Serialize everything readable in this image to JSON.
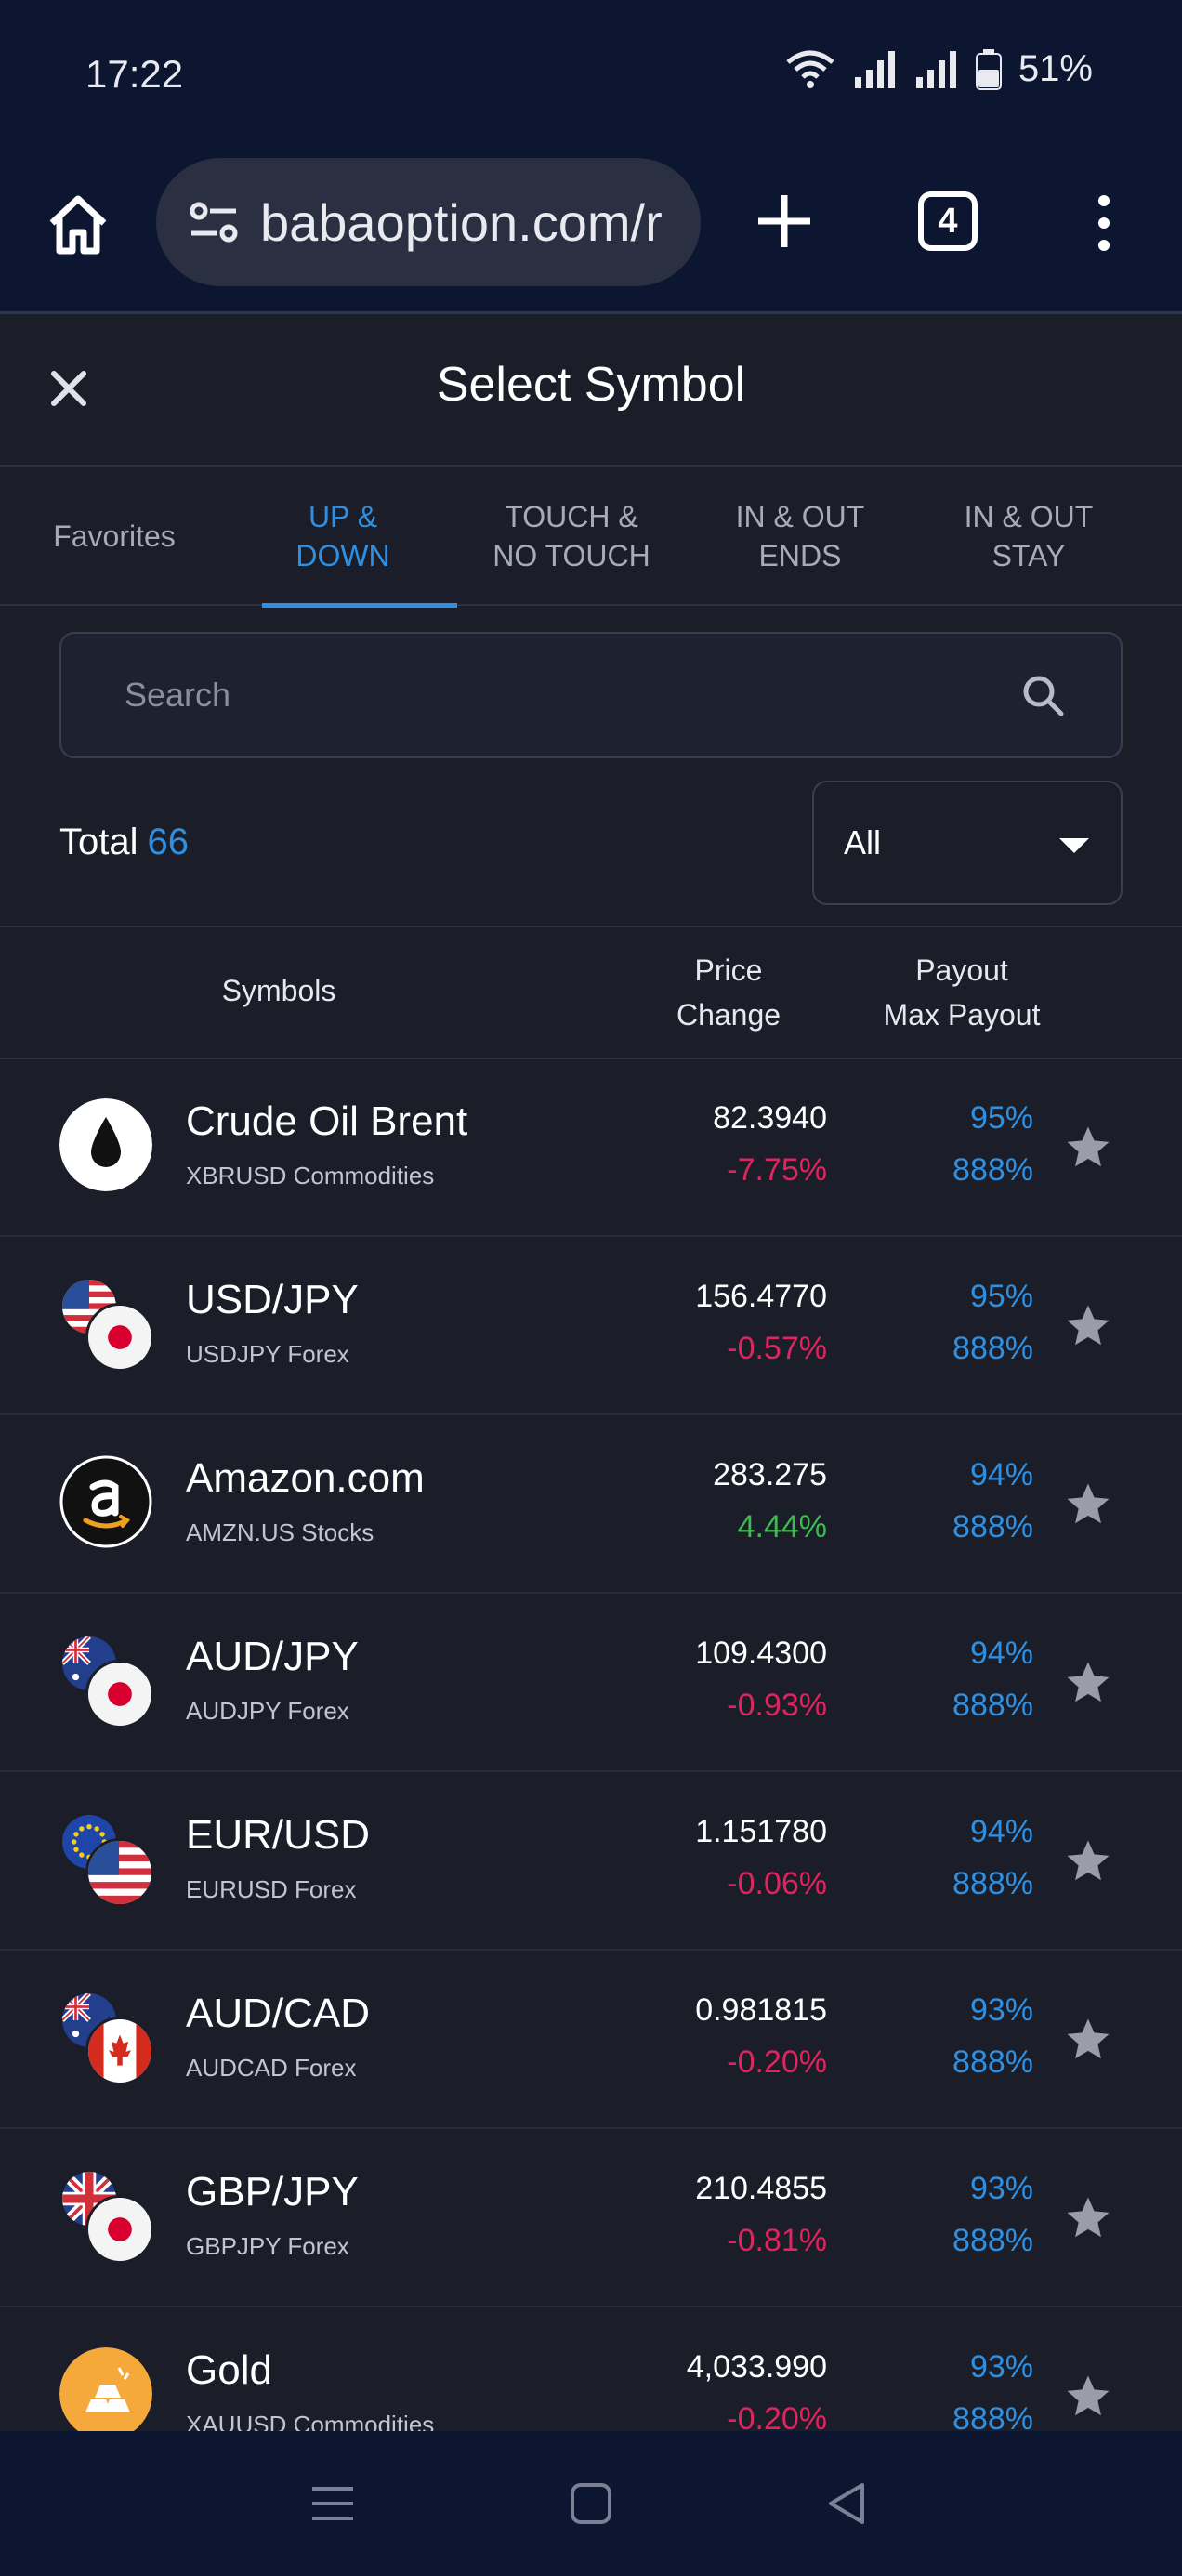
{
  "status_bar": {
    "time": "17:22",
    "battery": "51%"
  },
  "browser": {
    "url": "babaoption.com/r",
    "tab_count": "4"
  },
  "header": {
    "title": "Select Symbol"
  },
  "tabs": [
    {
      "label": "Favorites",
      "active": false
    },
    {
      "label": "UP &\nDOWN",
      "active": true
    },
    {
      "label": "TOUCH &\nNO TOUCH",
      "active": false
    },
    {
      "label": "IN & OUT\nENDS",
      "active": false
    },
    {
      "label": "IN & OUT\nSTAY",
      "active": false
    }
  ],
  "search": {
    "placeholder": "Search"
  },
  "total": {
    "label": "Total",
    "count": "66"
  },
  "filter": {
    "selected": "All"
  },
  "columns": {
    "symbols": "Symbols",
    "price": "Price",
    "change": "Change",
    "payout": "Payout",
    "max_payout": "Max Payout"
  },
  "rows": [
    {
      "name": "Crude Oil Brent",
      "sub": "XBRUSD Commodities",
      "price": "82.3940",
      "change": "-7.75%",
      "payout": "95%",
      "max_payout": "888%"
    },
    {
      "name": "USD/JPY",
      "sub": "USDJPY Forex",
      "price": "156.4770",
      "change": "-0.57%",
      "payout": "95%",
      "max_payout": "888%"
    },
    {
      "name": "Amazon.com",
      "sub": "AMZN.US Stocks",
      "price": "283.275",
      "change": "4.44%",
      "payout": "94%",
      "max_payout": "888%"
    },
    {
      "name": "AUD/JPY",
      "sub": "AUDJPY Forex",
      "price": "109.4300",
      "change": "-0.93%",
      "payout": "94%",
      "max_payout": "888%"
    },
    {
      "name": "EUR/USD",
      "sub": "EURUSD Forex",
      "price": "1.151780",
      "change": "-0.06%",
      "payout": "94%",
      "max_payout": "888%"
    },
    {
      "name": "AUD/CAD",
      "sub": "AUDCAD Forex",
      "price": "0.981815",
      "change": "-0.20%",
      "payout": "93%",
      "max_payout": "888%"
    },
    {
      "name": "GBP/JPY",
      "sub": "GBPJPY Forex",
      "price": "210.4855",
      "change": "-0.81%",
      "payout": "93%",
      "max_payout": "888%"
    },
    {
      "name": "Gold",
      "sub": "XAUUSD Commodities",
      "price": "4,033.990",
      "change": "-0.20%",
      "payout": "93%",
      "max_payout": "888%"
    }
  ],
  "colors": {
    "accent": "#2f8fe0",
    "negative": "#e0245e",
    "positive": "#3fb950",
    "background": "#1b1d29",
    "bar_background": "#0d1630"
  }
}
